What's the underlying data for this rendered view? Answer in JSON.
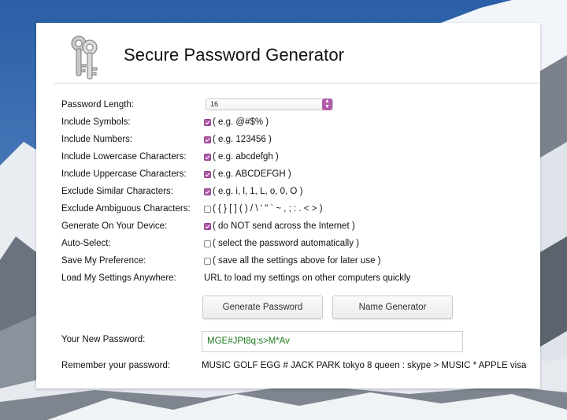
{
  "app": {
    "title": "Secure Password Generator",
    "logo_icon": "keys-icon"
  },
  "form": {
    "length": {
      "label": "Password Length:",
      "value": "16"
    },
    "rows": [
      {
        "label": "Include Symbols:",
        "checked": true,
        "text": "( e.g. @#$% )"
      },
      {
        "label": "Include Numbers:",
        "checked": true,
        "text": "( e.g. 123456 )"
      },
      {
        "label": "Include Lowercase Characters:",
        "checked": true,
        "text": "( e.g. abcdefgh )"
      },
      {
        "label": "Include Uppercase Characters:",
        "checked": true,
        "text": "( e.g. ABCDEFGH )"
      },
      {
        "label": "Exclude Similar Characters:",
        "checked": true,
        "text": "( e.g. i, l, 1, L, o, 0, O )"
      },
      {
        "label": "Exclude Ambiguous Characters:",
        "checked": false,
        "text": "( { } [ ] ( ) / \\ ' \" ` ~ , ; : . < > )"
      },
      {
        "label": "Generate On Your Device:",
        "checked": true,
        "text": "( do NOT send across the Internet )"
      },
      {
        "label": "Auto-Select:",
        "checked": false,
        "text": "( select the password automatically )"
      },
      {
        "label": "Save My Preference:",
        "checked": false,
        "text": "( save all the settings above for later use )"
      }
    ],
    "load_settings": {
      "label": "Load My Settings Anywhere:",
      "text": "URL to load my settings on other computers quickly"
    }
  },
  "buttons": {
    "generate": "Generate Password",
    "name_generator": "Name Generator"
  },
  "result": {
    "label": "Your New Password:",
    "password": "MGE#JPt8q:s>M*Av",
    "remember_label": "Remember your password:",
    "mnemonic": "MUSIC GOLF EGG # JACK PARK tokyo 8 queen : skype > MUSIC * APPLE visa"
  },
  "colors": {
    "accent": "#b05aa8",
    "password_text": "#1e7a1e"
  }
}
